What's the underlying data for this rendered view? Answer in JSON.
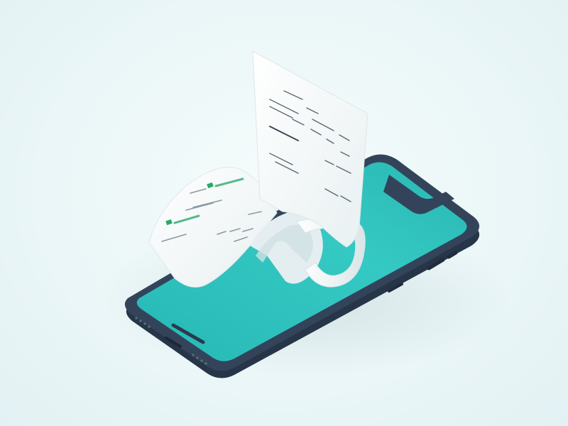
{
  "scene": {
    "colors": {
      "background": "#eef8f9",
      "phone_frame": "#2f3f52",
      "phone_screen": "#2fc4c0",
      "screen_highlight": "#57d8d2",
      "receipt_paper": "#f7fafa",
      "accent_green": "#2aa86a"
    }
  },
  "receipt": {
    "upper_lines": [
      "",
      "",
      "",
      "",
      "",
      "",
      ""
    ],
    "upper_title": "",
    "lower_brand": "",
    "lower_lines": [
      "",
      "",
      "",
      ""
    ]
  }
}
